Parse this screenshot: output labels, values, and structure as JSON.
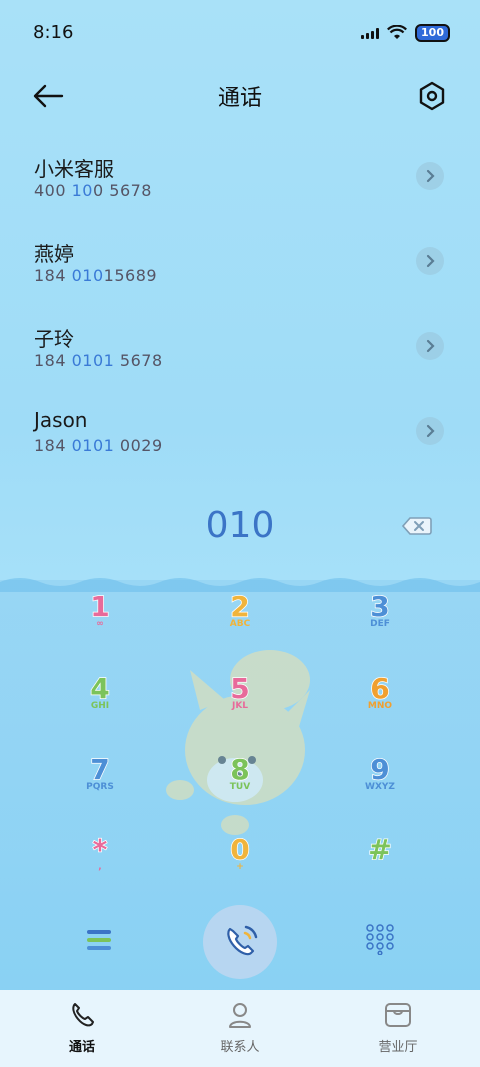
{
  "status": {
    "time": "8:16",
    "battery": "100"
  },
  "header": {
    "title": "通话"
  },
  "recent": [
    {
      "name": "小米客服",
      "num_pre": "400 ",
      "num_hl": "10",
      "num_mid": "0",
      "num_post": " 5678"
    },
    {
      "name": "燕婷",
      "num_pre": "184 ",
      "num_hl": "010",
      "num_mid": "",
      "num_post": "15689"
    },
    {
      "name": "子玲",
      "num_pre": "184 ",
      "num_hl": "0101",
      "num_mid": "",
      "num_post": " 5678"
    },
    {
      "name": "Jason",
      "num_pre": "184 ",
      "num_hl": "0101",
      "num_mid": "",
      "num_post": " 0029"
    }
  ],
  "dialer": {
    "input": "010",
    "keys": [
      {
        "digit": "1",
        "letters": "∞",
        "color": "#e86a9a"
      },
      {
        "digit": "2",
        "letters": "ABC",
        "color": "#f0b43c"
      },
      {
        "digit": "3",
        "letters": "DEF",
        "color": "#4d8fd6"
      },
      {
        "digit": "4",
        "letters": "GHI",
        "color": "#7cc35a"
      },
      {
        "digit": "5",
        "letters": "JKL",
        "color": "#e86a9a"
      },
      {
        "digit": "6",
        "letters": "MNO",
        "color": "#f0a030"
      },
      {
        "digit": "7",
        "letters": "PQRS",
        "color": "#4d8fd6"
      },
      {
        "digit": "8",
        "letters": "TUV",
        "color": "#7cc35a"
      },
      {
        "digit": "9",
        "letters": "WXYZ",
        "color": "#4d8fd6"
      },
      {
        "digit": "*",
        "letters": ",",
        "color": "#e86a9a"
      },
      {
        "digit": "0",
        "letters": "+",
        "color": "#f0b43c"
      },
      {
        "digit": "#",
        "letters": "",
        "color": "#7cc35a"
      }
    ]
  },
  "nav": [
    {
      "label": "通话"
    },
    {
      "label": "联系人"
    },
    {
      "label": "营业厅"
    }
  ]
}
